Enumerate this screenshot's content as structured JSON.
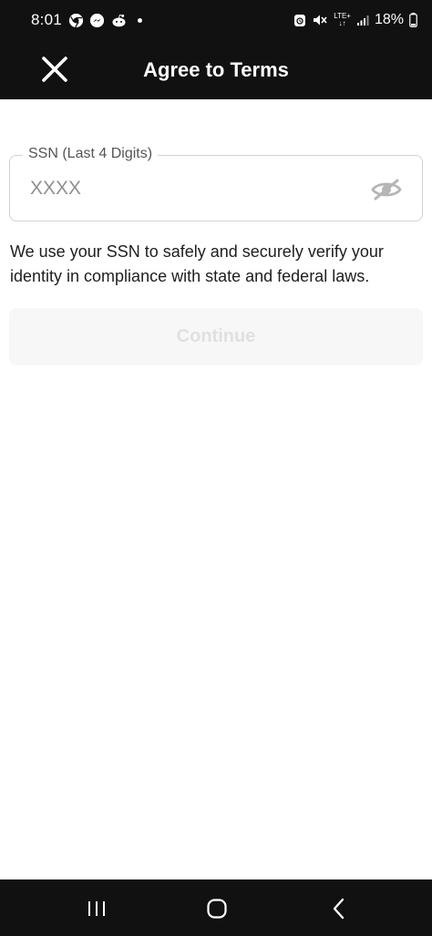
{
  "status_bar": {
    "time": "8:01",
    "battery": "18%",
    "network": "LTE+",
    "notification_icons": [
      "chrome-icon",
      "messenger-icon",
      "reddit-icon"
    ],
    "text_color": "#ffffff",
    "background": "#111111"
  },
  "header": {
    "title": "Agree to Terms",
    "close_icon": "close-icon"
  },
  "ssn_field": {
    "label": "SSN (Last 4 Digits)",
    "placeholder": "XXXX",
    "value": "",
    "visibility_icon": "eye-off-icon"
  },
  "info_text": "We use your SSN to safely and securely verify your identity in compliance with state and federal laws.",
  "continue_button": {
    "label": "Continue",
    "state": "disabled"
  },
  "nav_bar": {
    "icons": [
      "recent-apps-icon",
      "home-icon",
      "back-icon"
    ]
  }
}
